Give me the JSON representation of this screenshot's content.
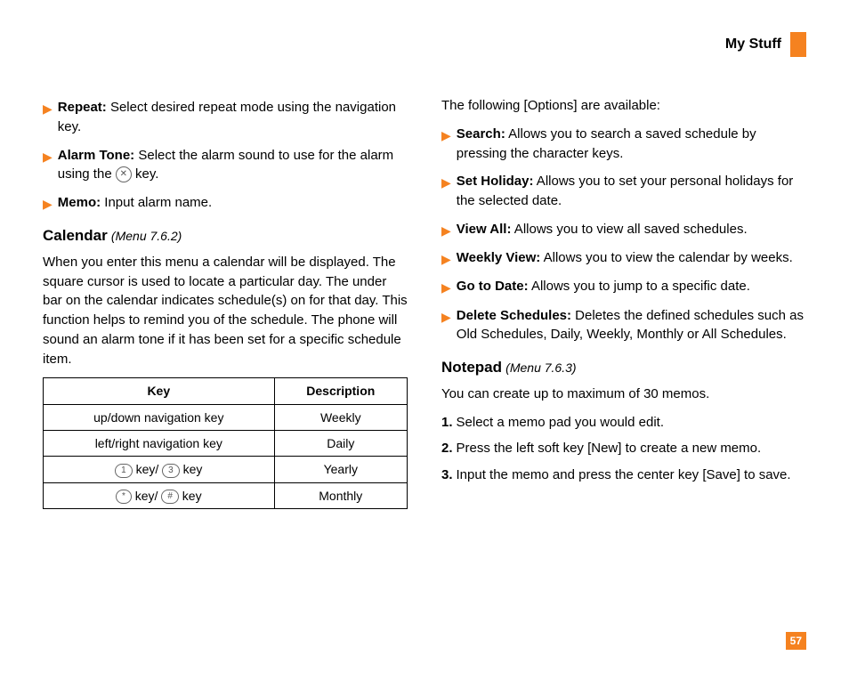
{
  "header": {
    "title": "My Stuff"
  },
  "left": {
    "items": [
      {
        "label": "Repeat:",
        "text": " Select desired repeat mode using the navigation key."
      },
      {
        "label": "Alarm Tone:",
        "text_before": " Select the alarm sound to use for the alarm using the ",
        "key_glyph": "✕",
        "text_after": " key."
      },
      {
        "label": "Memo:",
        "text": " Input alarm name."
      }
    ],
    "calendar": {
      "title": "Calendar",
      "menu": "(Menu 7.6.2)",
      "para": "When you enter this menu a calendar will be displayed. The square cursor is used to locate a particular day. The under bar on the calendar indicates schedule(s) on for that day. This function helps to remind you of the schedule. The phone will sound an alarm tone if it has been set for a specific schedule item."
    },
    "table": {
      "head_key": "Key",
      "head_desc": "Description",
      "rows": [
        {
          "key_text": "up/down navigation key",
          "desc": "Weekly"
        },
        {
          "key_text": "left/right navigation key",
          "desc": "Daily"
        },
        {
          "icon1": "1",
          "mid": " key/ ",
          "icon2": "3",
          "suffix": " key",
          "desc": "Yearly"
        },
        {
          "icon1": "*",
          "mid": " key/ ",
          "icon2": "#",
          "suffix": " key",
          "desc": "Monthly"
        }
      ]
    }
  },
  "right": {
    "intro": "The following [Options] are available:",
    "options": [
      {
        "label": "Search:",
        "text": " Allows you to search a saved schedule by pressing the character keys."
      },
      {
        "label": "Set Holiday:",
        "text": " Allows you to set your personal holidays for the selected date."
      },
      {
        "label": "View All:",
        "text": " Allows you to view all saved schedules."
      },
      {
        "label": "Weekly View:",
        "text": " Allows you to view the calendar by weeks."
      },
      {
        "label": "Go to Date:",
        "text": " Allows you to jump to a specific date."
      },
      {
        "label": "Delete Schedules:",
        "text": " Deletes the defined schedules such as Old Schedules, Daily, Weekly, Monthly or All Schedules."
      }
    ],
    "notepad": {
      "title": "Notepad",
      "menu": "(Menu 7.6.3)",
      "para": "You can create up to maximum of 30 memos.",
      "steps": [
        {
          "n": "1.",
          "t": "Select a memo pad you would edit."
        },
        {
          "n": "2.",
          "t": "Press the left soft key [New] to create a new memo."
        },
        {
          "n": "3.",
          "t": "Input the memo and press the center key [Save] to save."
        }
      ]
    }
  },
  "page_number": "57"
}
